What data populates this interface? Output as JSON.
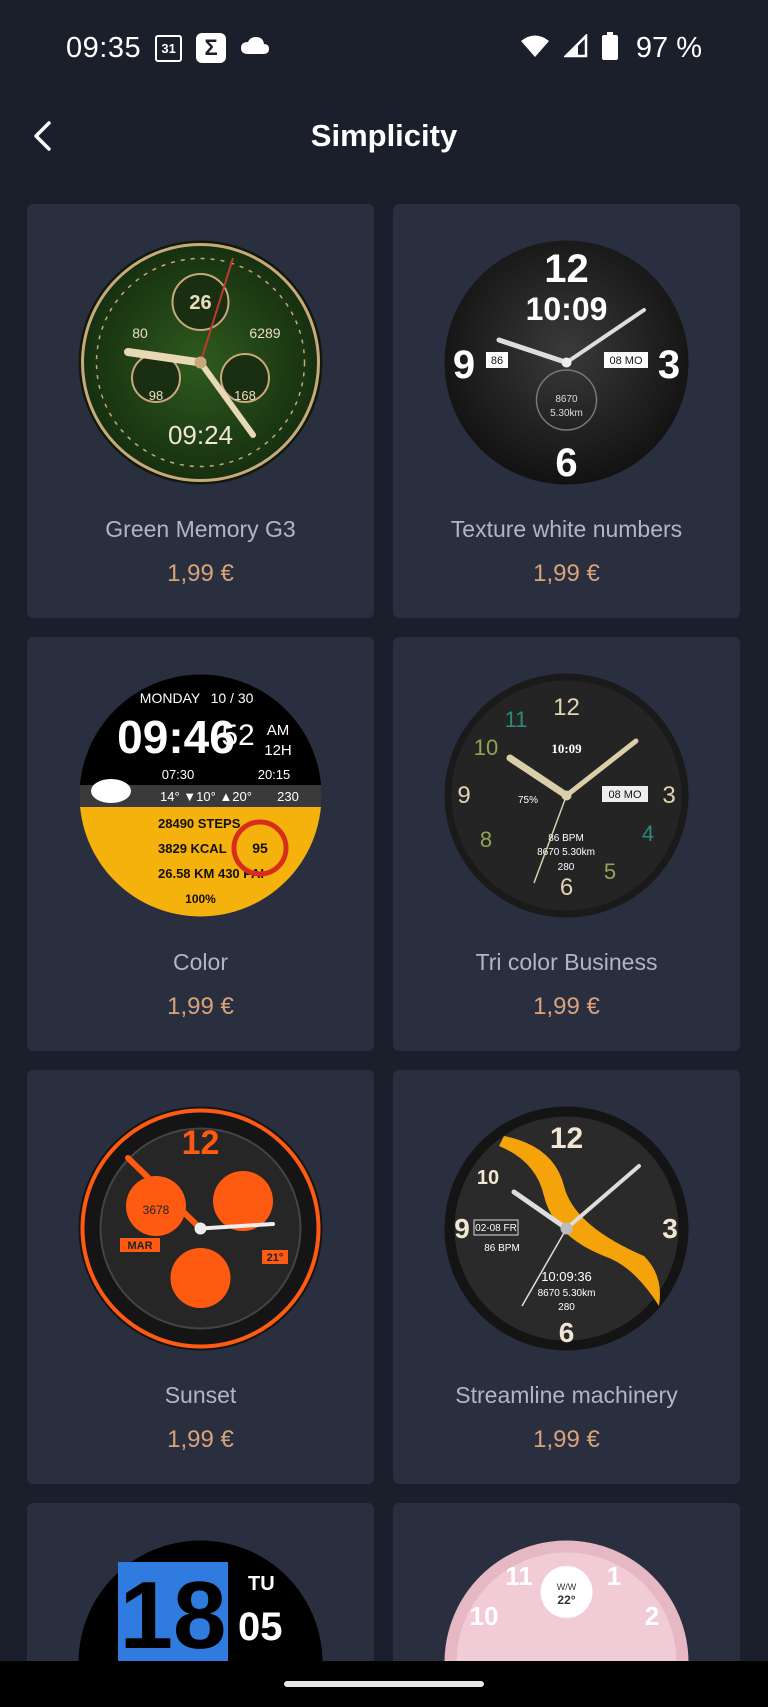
{
  "status_bar": {
    "time": "09:35",
    "calendar_day": "31",
    "battery_text": "97 %"
  },
  "header": {
    "title": "Simplicity"
  },
  "products": [
    {
      "name": "Green Memory G3",
      "price": "1,99 €",
      "face_time": "09:24"
    },
    {
      "name": "Texture white numbers",
      "price": "1,99 €",
      "face_time": "10:09"
    },
    {
      "name": "Color",
      "price": "1,99 €",
      "face_time": "09:46"
    },
    {
      "name": "Tri color Business",
      "price": "1,99 €",
      "face_time": "10:09"
    },
    {
      "name": "Sunset",
      "price": "1,99 €",
      "face_time": "12"
    },
    {
      "name": "Streamline machinery",
      "price": "1,99 €",
      "face_time": "10:09:36"
    }
  ],
  "partial_products": [
    {
      "face_text": "18"
    },
    {
      "face_text": "22°"
    }
  ],
  "colors": {
    "background": "#1b1f2c",
    "card": "#2a2f3f",
    "price": "#d9a37a",
    "name": "#b3b6c0"
  }
}
